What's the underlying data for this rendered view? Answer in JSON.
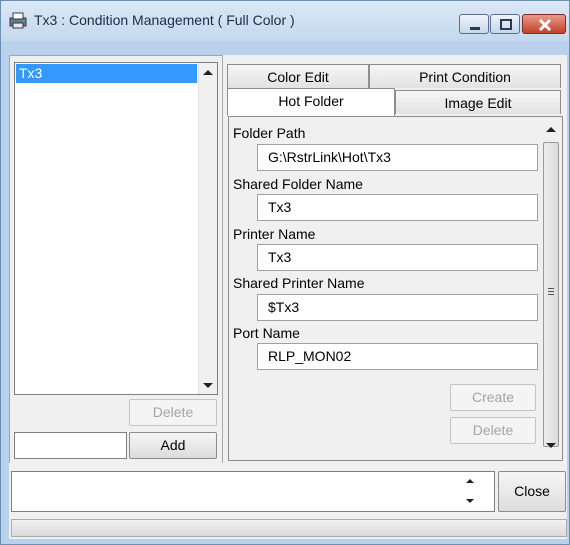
{
  "window": {
    "title": "Tx3 : Condition Management ( Full Color )"
  },
  "conditions_list": {
    "items": [
      "Tx3"
    ],
    "selected": "Tx3"
  },
  "left_buttons": {
    "delete_label": "Delete",
    "add_label": "Add",
    "name_input_value": ""
  },
  "tabs": [
    {
      "label": "Color Edit"
    },
    {
      "label": "Print Condition"
    },
    {
      "label": "Hot Folder"
    },
    {
      "label": "Image Edit"
    }
  ],
  "active_tab": "Hot Folder",
  "hot_folder": {
    "folder_path_label": "Folder Path",
    "folder_path_value": "G:\\RstrLink\\Hot\\Tx3",
    "shared_folder_name_label": "Shared Folder Name",
    "shared_folder_name_value": "Tx3",
    "printer_name_label": "Printer Name",
    "printer_name_value": "Tx3",
    "shared_printer_name_label": "Shared Printer Name",
    "shared_printer_name_value": "$Tx3",
    "port_name_label": "Port Name",
    "port_name_value": "RLP_MON02",
    "create_label": "Create",
    "delete_label": "Delete"
  },
  "footer": {
    "message": "",
    "close_label": "Close"
  },
  "icons": {
    "app": "printer-app-icon",
    "minimize": "minimize-icon",
    "maximize": "maximize-icon",
    "close": "close-icon"
  }
}
